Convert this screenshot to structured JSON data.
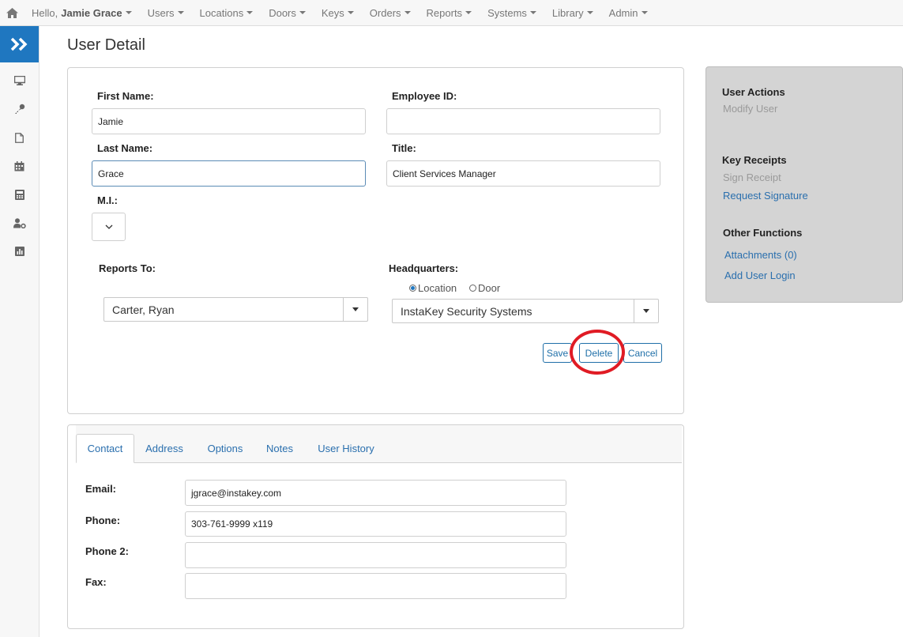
{
  "nav": {
    "hello_prefix": "Hello,",
    "user_name": "Jamie Grace",
    "items": [
      "Users",
      "Locations",
      "Doors",
      "Keys",
      "Orders",
      "Reports",
      "Systems",
      "Library",
      "Admin"
    ]
  },
  "sidebar": {
    "toggle_icon": "double-chevron-right-icon",
    "icons": [
      "monitor-icon",
      "key-icon",
      "document-icon",
      "calendar-icon",
      "calculator-icon",
      "user-settings-icon",
      "chart-icon"
    ]
  },
  "page": {
    "title": "User Detail"
  },
  "form": {
    "first_name_label": "First Name:",
    "first_name_value": "Jamie",
    "employee_id_label": "Employee ID:",
    "employee_id_value": "",
    "last_name_label": "Last Name:",
    "last_name_value": "Grace",
    "title_label": "Title:",
    "title_value": "Client Services Manager",
    "mi_label": "M.I.:",
    "reports_to_label": "Reports To:",
    "reports_to_value": "Carter, Ryan",
    "headquarters_label": "Headquarters:",
    "hq_option_location": "Location",
    "hq_option_door": "Door",
    "hq_selected": "Location",
    "headquarters_value": "InstaKey Security Systems",
    "save_label": "Save",
    "delete_label": "Delete",
    "cancel_label": "Cancel"
  },
  "actions": {
    "user_actions_heading": "User Actions",
    "modify_user": "Modify User",
    "key_receipts_heading": "Key Receipts",
    "sign_receipt": "Sign Receipt",
    "request_signature": "Request Signature",
    "other_functions_heading": "Other Functions",
    "attachments": "Attachments (0)",
    "add_user_login": "Add User Login"
  },
  "tabs": {
    "items": [
      "Contact",
      "Address",
      "Options",
      "Notes",
      "User History"
    ],
    "active": "Contact"
  },
  "contact": {
    "email_label": "Email:",
    "email_value": "jgrace@instakey.com",
    "phone_label": "Phone:",
    "phone_value": "303-761-9999 x119",
    "phone2_label": "Phone 2:",
    "phone2_value": "",
    "fax_label": "Fax:",
    "fax_value": ""
  },
  "colors": {
    "accent": "#1f77c0",
    "link": "#2a6fae",
    "highlight_circle": "#e01b24",
    "panel_bg": "#d4d4d4"
  }
}
